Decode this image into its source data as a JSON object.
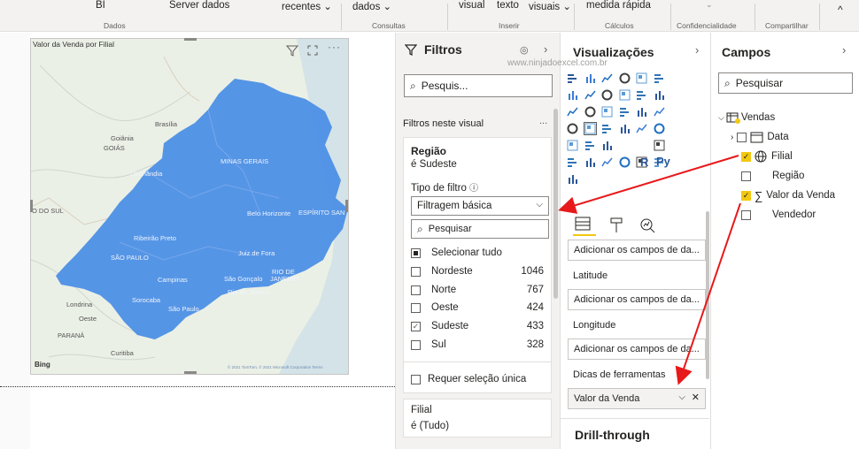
{
  "ribbon": {
    "items": [
      "BI",
      "Server dados",
      "recentes ⌄",
      "dados ⌄",
      "visual",
      "texto",
      "visuais ⌄",
      "medida rápida",
      "⌄"
    ],
    "groups": [
      "Dados",
      "Consultas",
      "Inserir",
      "Cálculos",
      "Confidencialidade",
      "Compartilhar"
    ],
    "collapse": "^"
  },
  "map": {
    "title": "Valor da Venda por Filial",
    "labels": {
      "brasilia": "Brasília",
      "goiania": "Goiânia",
      "goias": "GOIÁS",
      "minas": "MINAS GERAIS",
      "uberlandia": "Uberlândia",
      "riodosul": "O DO SUL",
      "bh": "Belo Horizonte",
      "es": "ESPÍRITO SAN",
      "ribeirao": "Ribeirão Preto",
      "sp_state": "SÃO PAULO",
      "jf": "Juiz de Fora",
      "rj_state": "RIO DE",
      "rj_state2": "JANEIRO",
      "campinas": "Campinas",
      "sg": "São Gonçalo",
      "rj": "Rio de Janeiro",
      "sorocaba": "Sorocaba",
      "sp": "São Paulo",
      "londrina": "Londrina",
      "oeste": "Oeste",
      "parana": "PARANÁ",
      "curitiba": "Curitiba",
      "bing": "Bing",
      "copyright": "© 2021 TomTom, © 2021 Microsoft Corporation  Terms"
    }
  },
  "filters": {
    "title": "Filtros",
    "search_placeholder": "Pesquis...",
    "section": "Filtros neste visual",
    "more": "...",
    "card": {
      "field": "Região",
      "summary": "é Sudeste",
      "filter_type_label": "Tipo de filtro",
      "filter_type": "Filtragem básica",
      "search_placeholder": "Pesquisar",
      "select_all": "Selecionar tudo",
      "items": [
        {
          "label": "Nordeste",
          "count": "1046",
          "checked": false
        },
        {
          "label": "Norte",
          "count": "767",
          "checked": false
        },
        {
          "label": "Oeste",
          "count": "424",
          "checked": false
        },
        {
          "label": "Sudeste",
          "count": "433",
          "checked": true
        },
        {
          "label": "Sul",
          "count": "328",
          "checked": false
        }
      ],
      "single_select": "Requer seleção única"
    },
    "card2": {
      "field": "Filial",
      "summary": "é (Tudo)"
    }
  },
  "viz": {
    "title": "Visualizações",
    "watermark": "www.ninjadoexcel.com.br",
    "wells": {
      "add_fields": "Adicionar os campos de da...",
      "latitude": "Latitude",
      "longitude": "Longitude",
      "tooltips": "Dicas de ferramentas",
      "tooltip_value": "Valor da Venda",
      "drill": "Drill-through"
    },
    "icon_r": "R",
    "icon_py": "Py",
    "accent": "#f2c811"
  },
  "fields": {
    "title": "Campos",
    "search_placeholder": "Pesquisar",
    "table": "Vendas",
    "items": {
      "data": "Data",
      "filial": "Filial",
      "regiao": "Região",
      "valor": "Valor da Venda",
      "vendedor": "Vendedor"
    }
  },
  "colors": {
    "map_fill": "#4d8fe6",
    "arrow": "#e8191b",
    "check": "#f2c811"
  }
}
